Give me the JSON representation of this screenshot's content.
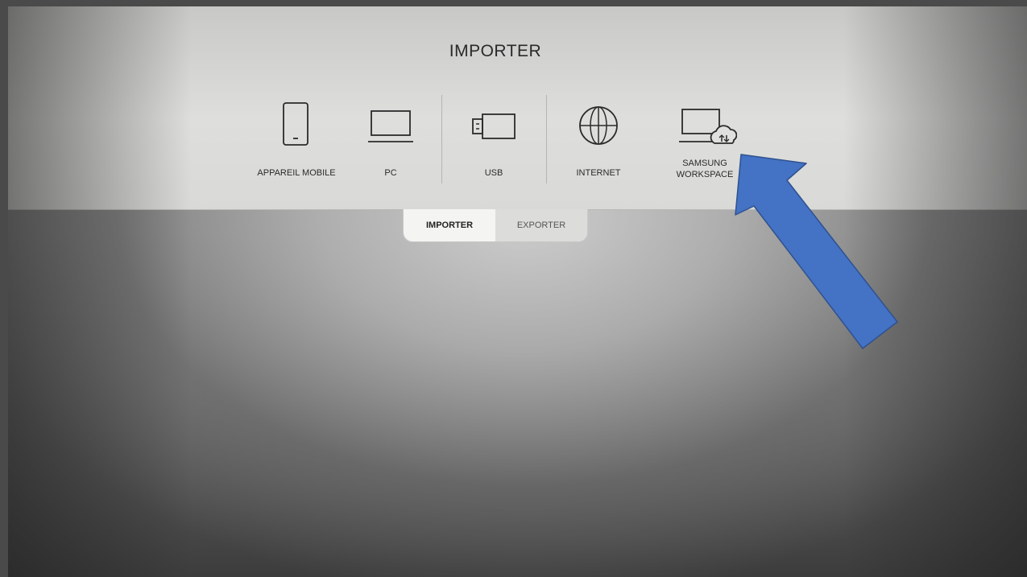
{
  "screen": {
    "title": "IMPORTER",
    "sources": [
      {
        "label": "APPAREIL MOBILE",
        "icon": "mobile-phone-icon"
      },
      {
        "label": "PC",
        "icon": "laptop-icon"
      },
      {
        "label": "USB",
        "icon": "usb-drive-icon"
      },
      {
        "label": "INTERNET",
        "icon": "globe-icon"
      },
      {
        "label": "SAMSUNG\nWORKSPACE",
        "icon": "laptop-cloud-icon"
      }
    ],
    "tabs": [
      {
        "label": "IMPORTER",
        "active": true
      },
      {
        "label": "EXPORTER",
        "active": false
      }
    ]
  },
  "annotation": {
    "arrow_color": "#4472C4",
    "arrow_outline": "#2F528F",
    "points_to": "samsung-workspace"
  }
}
